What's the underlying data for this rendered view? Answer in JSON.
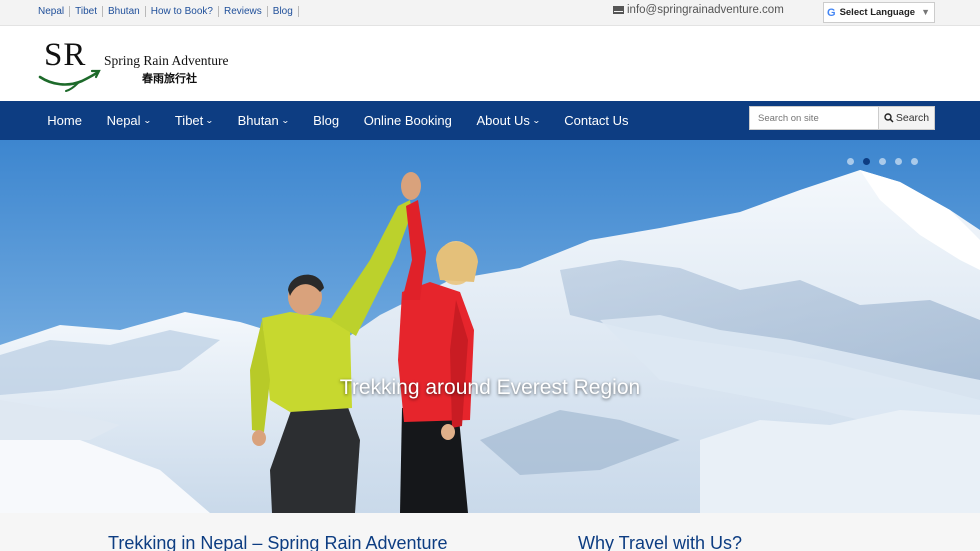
{
  "topbar": {
    "links": [
      "Nepal",
      "Tibet",
      "Bhutan",
      "How to Book?",
      "Reviews",
      "Blog"
    ],
    "email": "info@springrainadventure.com",
    "language_label": "Select Language"
  },
  "logo": {
    "initials": "SR",
    "name": "Spring Rain Adventure",
    "chinese_name": "春雨旅行社"
  },
  "nav": {
    "items": [
      {
        "label": "Home",
        "dropdown": false
      },
      {
        "label": "Nepal",
        "dropdown": true
      },
      {
        "label": "Tibet",
        "dropdown": true
      },
      {
        "label": "Bhutan",
        "dropdown": true
      },
      {
        "label": "Blog",
        "dropdown": false
      },
      {
        "label": "Online Booking",
        "dropdown": false
      },
      {
        "label": "About Us",
        "dropdown": true
      },
      {
        "label": "Contact Us",
        "dropdown": false
      }
    ],
    "search_placeholder": "Search on site",
    "search_button": "Search"
  },
  "hero": {
    "caption": "Trekking around Everest Region",
    "slide_count": 5,
    "active_slide": 2
  },
  "sections": {
    "left_heading": "Trekking in Nepal – Spring Rain Adventure",
    "right_heading": "Why Travel with Us?"
  },
  "colors": {
    "nav_bg": "#0d3d82",
    "link_blue": "#1f4f9a",
    "heading_blue": "#0d3d82"
  }
}
